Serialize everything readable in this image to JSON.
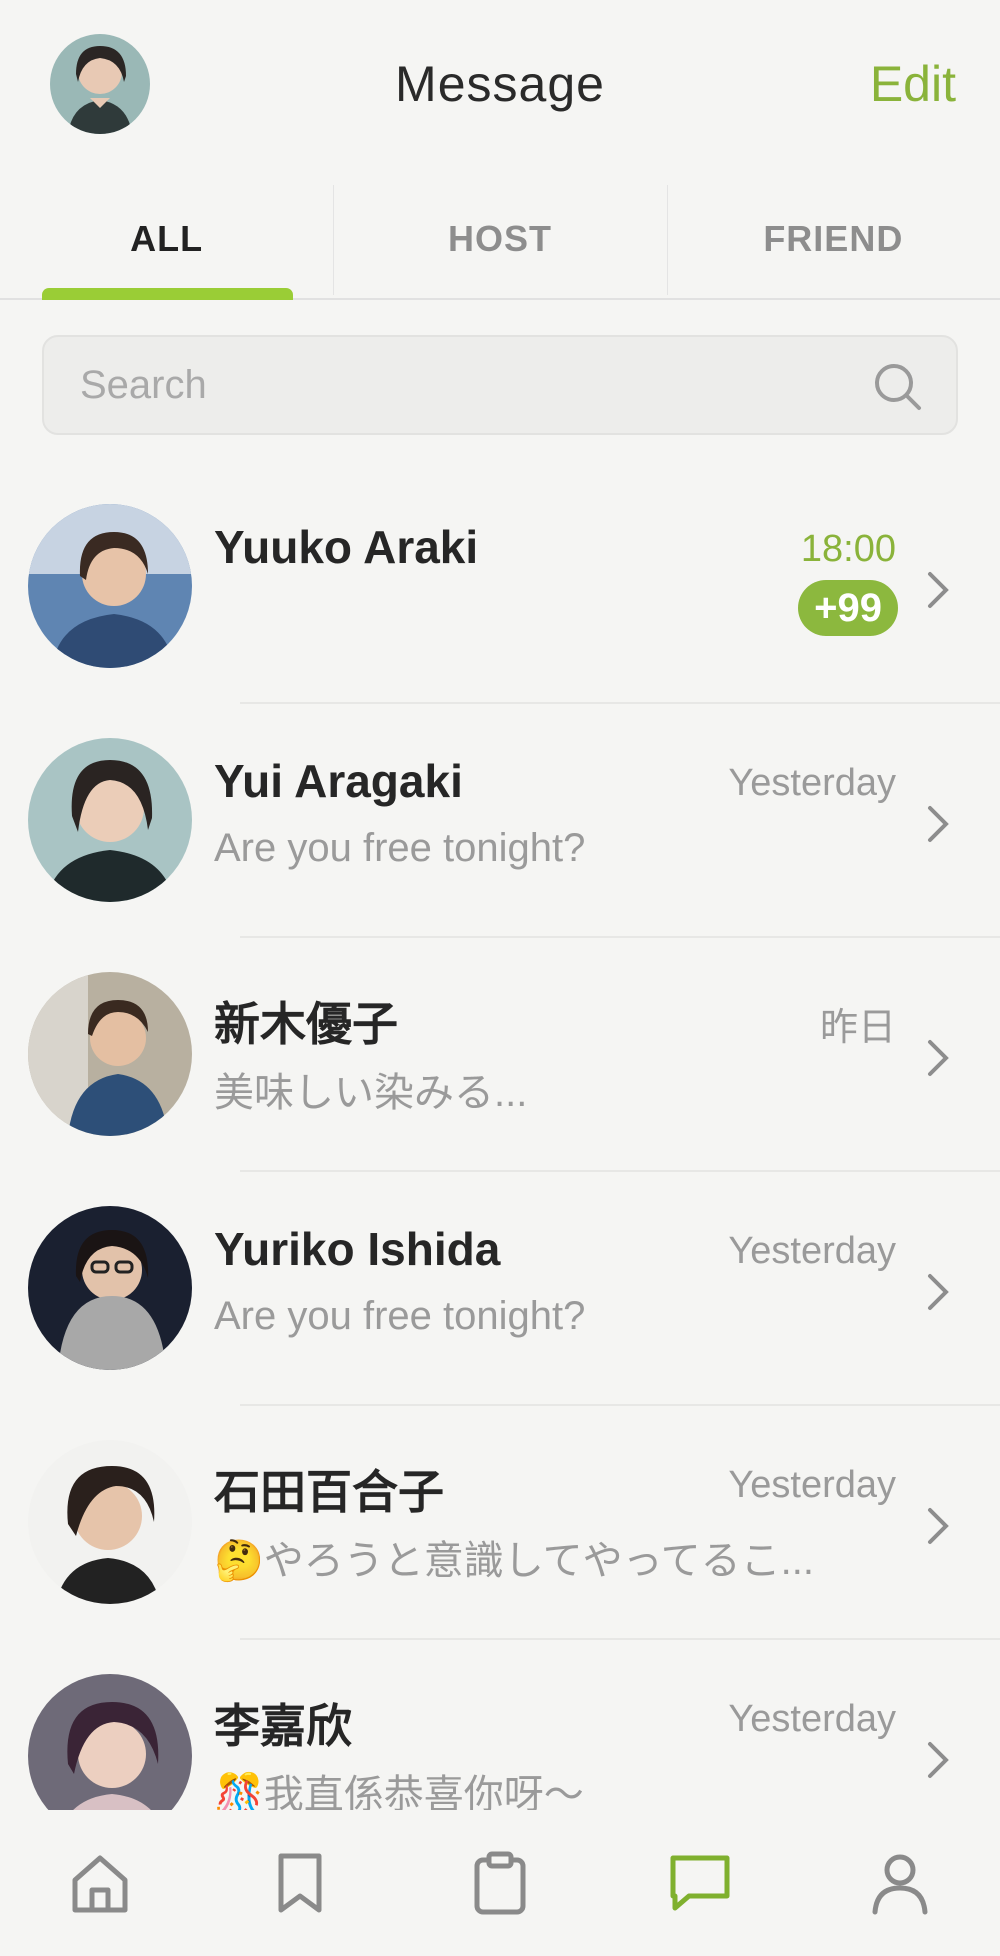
{
  "header": {
    "title": "Message",
    "edit_label": "Edit"
  },
  "tabs": [
    {
      "label": "ALL",
      "active": true
    },
    {
      "label": "HOST",
      "active": false
    },
    {
      "label": "FRIEND",
      "active": false
    }
  ],
  "search": {
    "placeholder": "Search",
    "value": ""
  },
  "messages": [
    {
      "name": "Yuuko Araki",
      "preview": "",
      "time": "18:00",
      "badge": "+99"
    },
    {
      "name": "Yui Aragaki",
      "preview": "Are you free tonight?",
      "time": "Yesterday",
      "badge": ""
    },
    {
      "name": "新木優子",
      "preview": "美味しい染みる...",
      "time": "昨日",
      "badge": ""
    },
    {
      "name": "Yuriko Ishida",
      "preview": "Are you free tonight?",
      "time": "Yesterday",
      "badge": ""
    },
    {
      "name": "石田百合子",
      "preview": "🤔やろうと意識してやってるこ...",
      "time": "Yesterday",
      "badge": ""
    },
    {
      "name": "李嘉欣",
      "preview": "🎊我直係恭喜你呀～",
      "time": "Yesterday",
      "badge": ""
    }
  ],
  "colors": {
    "accent": "#8ab33a",
    "indicator": "#9acd36",
    "badge": "#8cb83e"
  },
  "nav": {
    "items": [
      {
        "icon": "home-icon",
        "active": false
      },
      {
        "icon": "bookmark-icon",
        "active": false
      },
      {
        "icon": "clipboard-icon",
        "active": false
      },
      {
        "icon": "chat-icon",
        "active": true
      },
      {
        "icon": "profile-icon",
        "active": false
      }
    ]
  }
}
